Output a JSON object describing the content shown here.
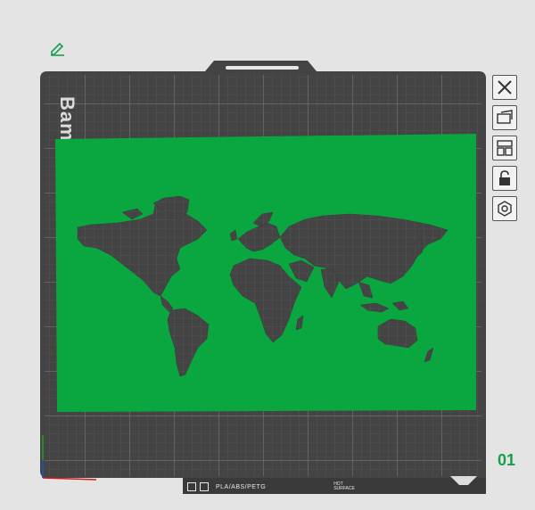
{
  "plate": {
    "brand_text": "Bam",
    "filament_label": "PLA/ABS/PETG",
    "hot_surface_line1": "HOT",
    "hot_surface_line2": "SURFACE",
    "plate_number": "01",
    "colors": {
      "plate": "#444444",
      "grid": "#6a6a6a",
      "model": "#0aa640",
      "accent_green": "#14a14a"
    }
  },
  "toolbar": {
    "items": [
      {
        "icon": "close-icon"
      },
      {
        "icon": "orient-icon"
      },
      {
        "icon": "arrange-icon"
      },
      {
        "icon": "lock-icon"
      },
      {
        "icon": "settings-hex-icon"
      }
    ]
  },
  "axes": {
    "x_color": "#d02020",
    "y_color": "#20a020",
    "z_color": "#2040d0"
  }
}
